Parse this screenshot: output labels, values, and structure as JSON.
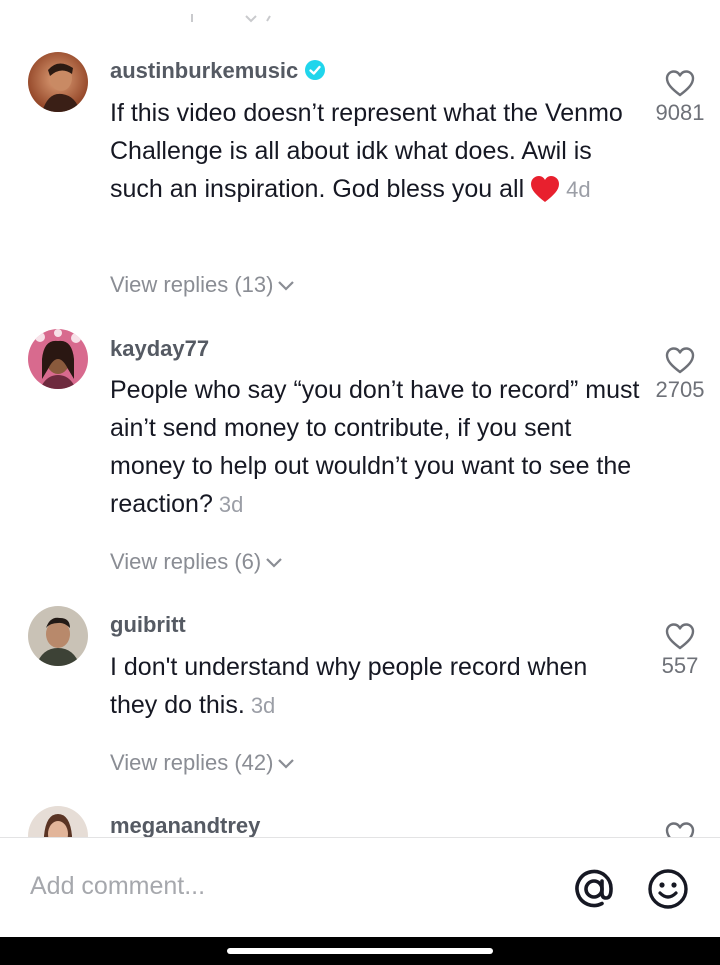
{
  "comments": [
    {
      "username": "austinburkemusic",
      "verified": true,
      "text": "If this video doesn’t represent what the Venmo Challenge is all about idk what does. Awil is such an inspiration. God bless you all",
      "emoji": "red-heart",
      "time": "4d",
      "replies": "View replies (13)",
      "likes": "9081"
    },
    {
      "username": "kayday77",
      "verified": false,
      "text": "People who say “you don’t have to record” must ain’t send money to contribute, if you sent money to help out wouldn’t you want to see the reaction?",
      "time": "3d",
      "replies": "View replies (6)",
      "likes": "2705"
    },
    {
      "username": "guibritt",
      "verified": false,
      "text": "I don't understand why people record when they do this.",
      "time": "3d",
      "replies": "View replies (42)",
      "likes": "557"
    },
    {
      "username": "meganandtrey",
      "verified": false
    }
  ],
  "comment_input": {
    "placeholder": "Add comment..."
  },
  "icons": {
    "mention": "at-sign-icon",
    "emoji": "smiley-icon",
    "like": "heart-outline-icon",
    "verified": "verified-badge-icon"
  },
  "colors": {
    "verified": "#20d5ec",
    "heart_emoji": "#e8202e",
    "username": "#555a63",
    "muted": "#8a8d94"
  }
}
